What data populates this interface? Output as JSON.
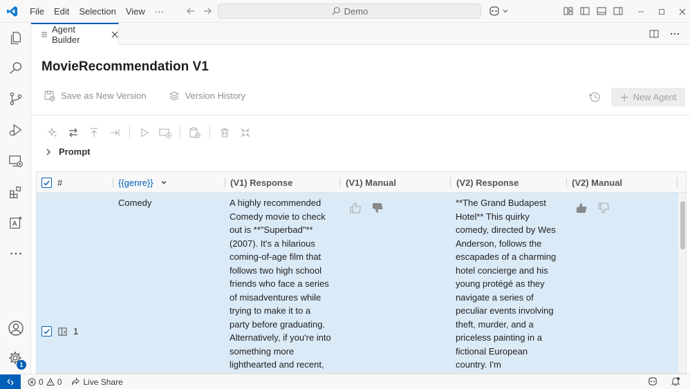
{
  "menu": [
    "File",
    "Edit",
    "Selection",
    "View",
    "···"
  ],
  "command_center": {
    "text": "Demo"
  },
  "tab": {
    "label": "Agent Builder"
  },
  "page": {
    "title": "MovieRecommendation V1"
  },
  "toolbar": {
    "save_label": "Save as New Version",
    "history_label": "Version History",
    "new_agent_label": "New Agent"
  },
  "prompt": {
    "label": "Prompt"
  },
  "table": {
    "headers": {
      "index": "#",
      "variable": "{{genre}}",
      "v1_response": "(V1) Response",
      "v1_manual": "(V1) Manual",
      "v2_response": "(V2) Response",
      "v2_manual": "(V2) Manual"
    },
    "row": {
      "index": "1",
      "genre": "Comedy",
      "v1_response": [
        "A highly recommended",
        "Comedy movie to check",
        "out is **\"Superbad\"**",
        "(2007). It's a hilarious",
        "coming-of-age film that",
        "follows two high school",
        "friends who face a series",
        "of misadventures while",
        "trying to make it to a",
        "party before graduating.",
        "Alternatively, if you're into",
        "something more",
        "lighthearted and recent,"
      ],
      "v2_response": [
        "**The Grand Budapest",
        "Hotel** This quirky",
        "comedy, directed by Wes",
        "Anderson, follows the",
        "escapades of a charming",
        "hotel concierge and his",
        "young protégé as they",
        "navigate a series of",
        "peculiar events involving",
        "theft, murder, and a",
        "priceless painting in a",
        "fictional European",
        "country. I'm"
      ],
      "v1_feedback": "thumbs-down",
      "v2_feedback": "thumbs-up"
    }
  },
  "statusbar": {
    "errors": "0",
    "warnings": "0",
    "live_share": "Live Share",
    "badge": "1"
  },
  "colors": {
    "accent": "#005fb8",
    "row_selected": "#dbeaf7"
  }
}
